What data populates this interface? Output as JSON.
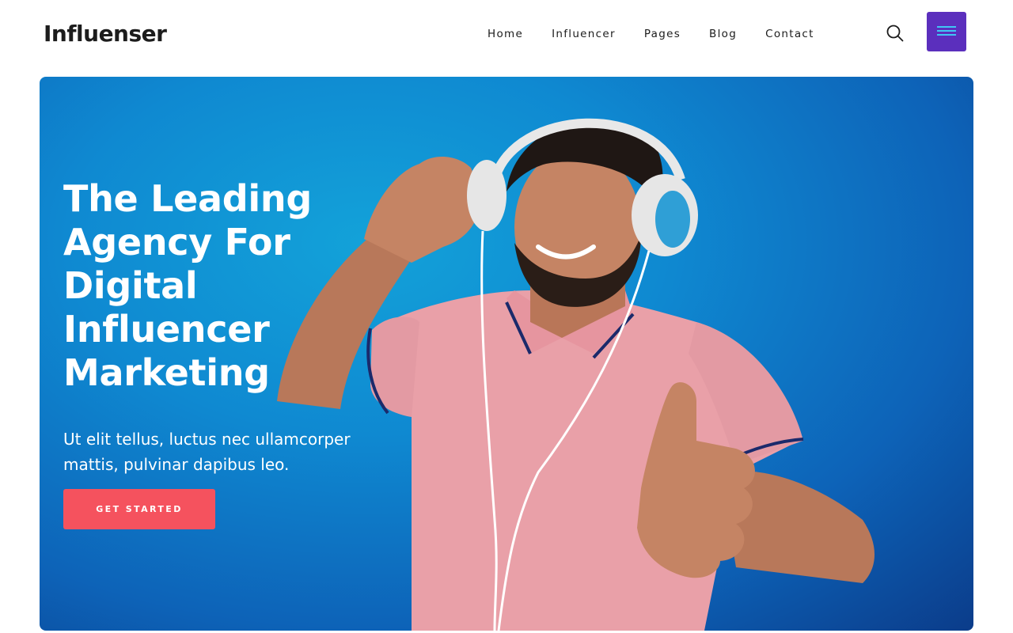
{
  "brand": {
    "logo_text": "Influenser"
  },
  "nav": {
    "items": [
      {
        "label": "Home"
      },
      {
        "label": "Influencer"
      },
      {
        "label": "Pages"
      },
      {
        "label": "Blog"
      },
      {
        "label": "Contact"
      }
    ]
  },
  "header_actions": {
    "search_icon": "search-icon",
    "menu_icon": "hamburger-menu-icon",
    "menu_button_color": "#5b2fbd",
    "menu_lines_color": "#3fc6f5"
  },
  "hero": {
    "title": "The Leading Agency For Digital Influencer Marketing",
    "subtitle": "Ut elit tellus, luctus nec ullamcorper mattis, pulvinar dapibus leo.",
    "cta_label": "GET STARTED",
    "cta_color": "#f5525e",
    "background_color": "#0f89d1",
    "image": "man-with-headphones-thumbs-up"
  }
}
